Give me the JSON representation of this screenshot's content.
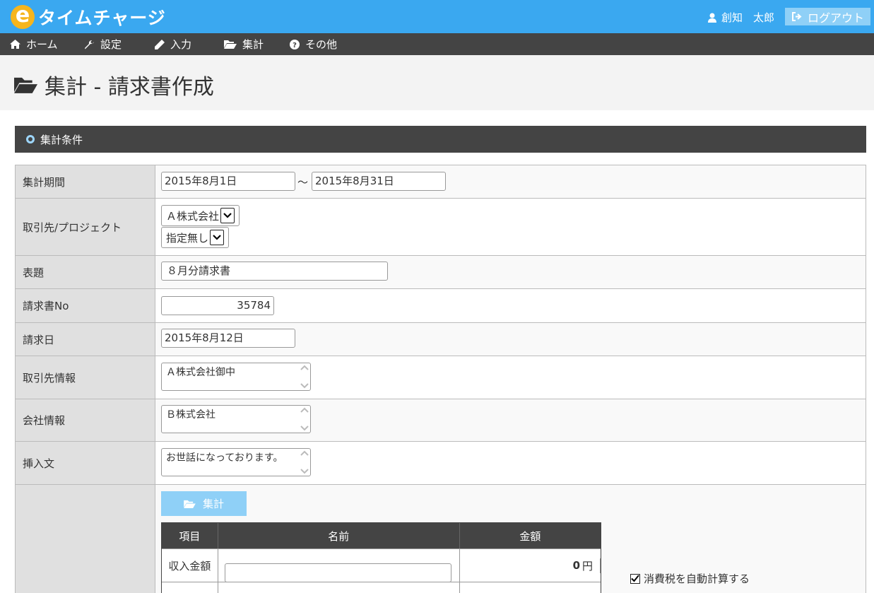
{
  "header": {
    "logo_letter": "e",
    "logo_text": "タイムチャージ",
    "user_name": "創知　太郎",
    "logout_label": "ログアウト"
  },
  "nav": [
    {
      "label": "ホーム",
      "icon": "home-icon"
    },
    {
      "label": "設定",
      "icon": "wrench-icon"
    },
    {
      "label": "入力",
      "icon": "pencil-icon"
    },
    {
      "label": "集計",
      "icon": "folder-open-icon"
    },
    {
      "label": "その他",
      "icon": "question-circle-icon"
    }
  ],
  "page": {
    "title": "集計 - 請求書作成"
  },
  "section": {
    "title": "集計条件"
  },
  "form": {
    "period": {
      "label": "集計期間",
      "from": "2015年8月1日",
      "sep": "～",
      "to": "2015年8月31日"
    },
    "client": {
      "label": "取引先/プロジェクト",
      "client_value": "Ａ株式会社",
      "project_value": "指定無し"
    },
    "subject": {
      "label": "表題",
      "value": "８月分請求書"
    },
    "invoice_no": {
      "label": "請求書No",
      "value": "35784"
    },
    "invoice_date": {
      "label": "請求日",
      "value": "2015年8月12日"
    },
    "client_info": {
      "label": "取引先情報",
      "value": "Ａ株式会社御中"
    },
    "company_info": {
      "label": "会社情報",
      "value": "Ｂ株式会社"
    },
    "insert_text": {
      "label": "挿入文",
      "value": "お世話になっております。"
    }
  },
  "calc": {
    "button_label": "集計",
    "columns": [
      "項目",
      "名前",
      "金額"
    ],
    "income_label": "収入金額",
    "income_amount": "0",
    "currency": "円",
    "auto_tax_label": "消費税を自動計算する"
  },
  "colors": {
    "header": "#3aa8f0",
    "nav": "#444444",
    "accent": "#8fd0f7",
    "logo": "#f6b51c"
  }
}
